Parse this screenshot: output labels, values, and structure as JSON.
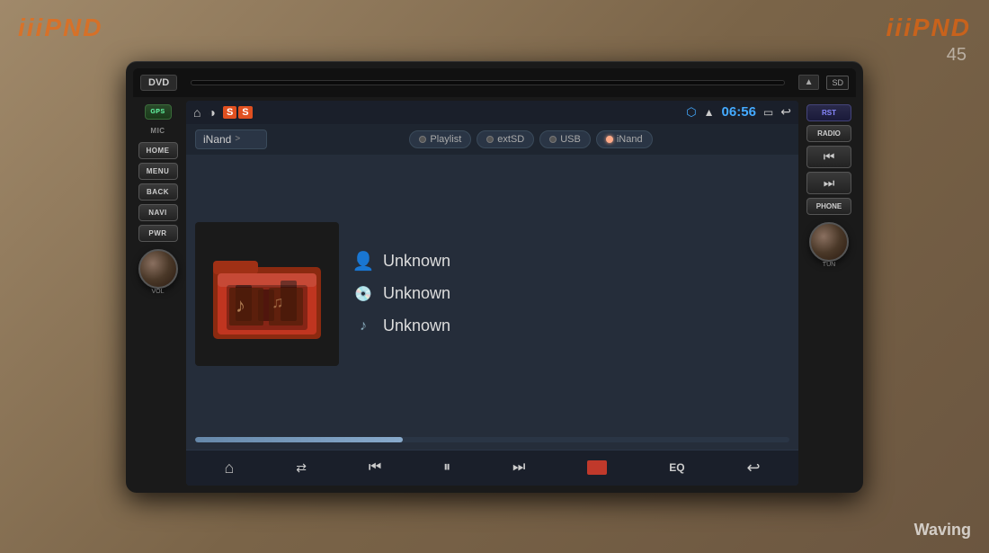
{
  "watermarks": {
    "left": "iiiPND",
    "right": "iiiPND",
    "bottom_right": "Waving",
    "number": "45"
  },
  "device": {
    "dvd_label": "DVD",
    "sd_label": "SD",
    "eject_symbol": "▲",
    "gps_label": "GPS",
    "mic_label": "MIC",
    "buttons_left": [
      "HOME",
      "MENU",
      "BACK",
      "NAVI",
      "PWR"
    ],
    "buttons_right": [
      "RST",
      "RADIO",
      "PHONE"
    ],
    "vol_label": "VOL",
    "tun_label": "TUN"
  },
  "status_bar": {
    "home_symbol": "⌂",
    "brightness_symbol": "◑",
    "ss_labels": [
      "S",
      "S"
    ],
    "bluetooth_symbol": "B",
    "wifi_symbol": "▲",
    "time": "06:56",
    "screen_symbol": "▭",
    "back_symbol": "↩"
  },
  "player": {
    "folder_name": "iNand",
    "arrow": ">",
    "source_tabs": [
      {
        "label": "Playlist",
        "active": false
      },
      {
        "label": "extSD",
        "active": false
      },
      {
        "label": "USB",
        "active": false
      },
      {
        "label": "iNand",
        "active": true
      }
    ],
    "track_info": {
      "artist": "Unknown",
      "album": "Unknown",
      "title": "Unknown"
    },
    "progress_percent": 35,
    "controls": {
      "home": "⌂",
      "shuffle": "⇄",
      "prev": "⏮",
      "play_pause": "⏸",
      "next": "⏭",
      "stop": "■",
      "eq": "EQ",
      "back": "↩"
    }
  }
}
